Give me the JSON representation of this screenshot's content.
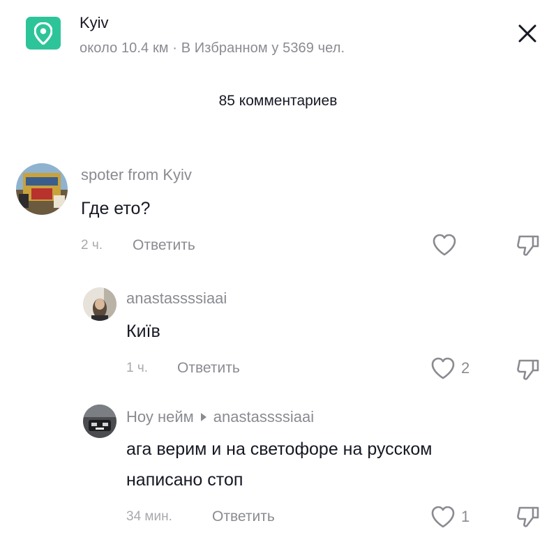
{
  "location": {
    "title": "Kyiv",
    "subtitle": "около 10.4 км · В Избранном у 5369 чел.",
    "icon": "location-pin-icon",
    "accent": "#2ec49a"
  },
  "comments_header": "85 комментариев",
  "comments": [
    {
      "username": "spoter from Kyiv",
      "text": "Где ето?",
      "time": "2 ч.",
      "reply_label": "Ответить",
      "likes": ""
    },
    {
      "username": "anastassssiaai",
      "text": "Київ",
      "time": "1 ч.",
      "reply_label": "Ответить",
      "likes": "2"
    },
    {
      "username": "Ноу нейм",
      "reply_to": "anastassssiaai",
      "text_line1": "ага верим и на светофоре на русском",
      "text_line2": "написано стоп",
      "time": "34 мин.",
      "reply_label": "Ответить",
      "likes": "1"
    }
  ]
}
